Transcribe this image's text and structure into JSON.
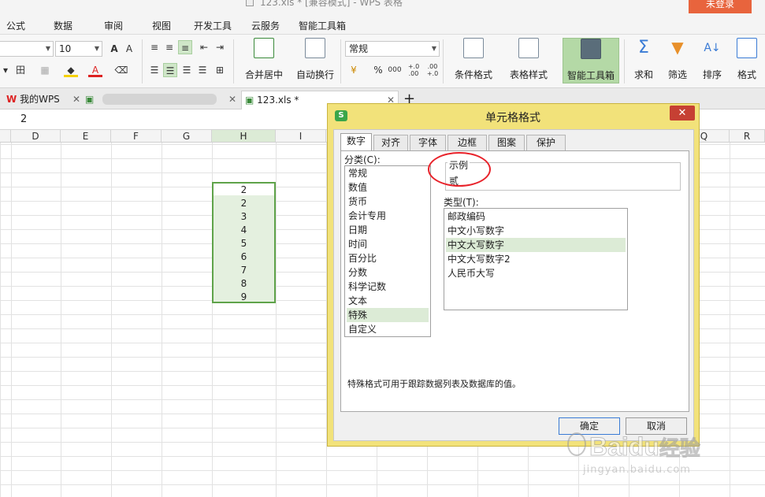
{
  "window": {
    "title": "123.xls * [兼容模式] - WPS 表格",
    "login_button": "未登录"
  },
  "menu": {
    "tabs": [
      "公式",
      "数据",
      "审阅",
      "视图",
      "开发工具",
      "云服务",
      "智能工具箱"
    ]
  },
  "ribbon": {
    "font_size": "10",
    "number_format": "常规",
    "merge_center": "合并居中",
    "wrap_text": "自动换行",
    "percent_symbol": "%",
    "thousands_symbol": "000",
    "dec_increase": "+.0\n.00",
    "dec_decrease": ".00\n+.0",
    "conditional_format": "条件格式",
    "table_style": "表格样式",
    "smart_toolbox": "智能工具箱",
    "sum": "求和",
    "filter": "筛选",
    "sort": "排序",
    "format": "格式"
  },
  "doc_tabs": {
    "tab1": "我的WPS",
    "tab3": "123.xls *",
    "new_tab": "+"
  },
  "formula_bar": {
    "value": "2"
  },
  "grid": {
    "columns": [
      "D",
      "E",
      "F",
      "G",
      "H",
      "I",
      "Q",
      "R"
    ],
    "selected_column": "H",
    "cell_values": [
      "2",
      "2",
      "3",
      "4",
      "5",
      "6",
      "7",
      "8",
      "9"
    ]
  },
  "dialog": {
    "title": "单元格格式",
    "close_symbol": "✕",
    "tabs": [
      "数字",
      "对齐",
      "字体",
      "边框",
      "图案",
      "保护"
    ],
    "active_tab": "数字",
    "category_label": "分类(C):",
    "categories": [
      "常规",
      "数值",
      "货币",
      "会计专用",
      "日期",
      "时间",
      "百分比",
      "分数",
      "科学记数",
      "文本",
      "特殊",
      "自定义"
    ],
    "selected_category": "特殊",
    "sample_label": "示例",
    "sample_value": "贰",
    "type_label": "类型(T):",
    "types": [
      "邮政编码",
      "中文小写数字",
      "中文大写数字",
      "中文大写数字2",
      "人民币大写"
    ],
    "selected_type": "中文大写数字",
    "description": "特殊格式可用于跟踪数据列表及数据库的值。",
    "ok_button": "确定",
    "cancel_button": "取消"
  },
  "watermark": {
    "brand": "Baidu",
    "brand_cn": "经验",
    "url": "jingyan.baidu.com"
  },
  "colors": {
    "selection_green": "#5fa34a",
    "dialog_frame": "#f2e27a",
    "close_red": "#c64033",
    "annotation_red": "#e8222a",
    "login_orange": "#e8643d"
  }
}
